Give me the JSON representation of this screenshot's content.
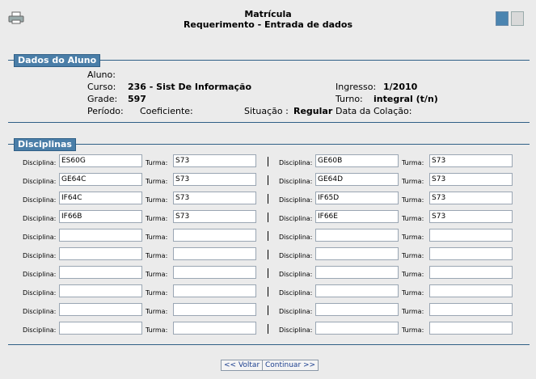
{
  "header": {
    "title": "Matrícula",
    "subtitle": "Requerimento - Entrada de dados"
  },
  "aluno": {
    "section_title": "Dados do Aluno",
    "aluno_label": "Aluno:",
    "curso_label": "Curso:",
    "curso_value": "236 - Sist De Informação",
    "grade_label": "Grade:",
    "grade_value": "597",
    "periodo_label": "Período:",
    "coeficiente_label": "Coeficiente:",
    "situacao_label": "Situação :",
    "situacao_value": "Regular",
    "ingresso_label": "Ingresso:",
    "ingresso_value": "1/2010",
    "turno_label": "Turno:",
    "turno_value": "integral (t/n)",
    "colacao_label": "Data da Colação:"
  },
  "disciplinas": {
    "section_title": "Disciplinas",
    "disciplina_label": "Disciplina:",
    "turma_label": "Turma:",
    "rows": [
      {
        "d1": "ES60G",
        "t1": "S73",
        "d2": "GE60B",
        "t2": "S73"
      },
      {
        "d1": "GE64C",
        "t1": "S73",
        "d2": "GE64D",
        "t2": "S73"
      },
      {
        "d1": "IF64C",
        "t1": "S73",
        "d2": "IF65D",
        "t2": "S73"
      },
      {
        "d1": "IF66B",
        "t1": "S73",
        "d2": "IF66E",
        "t2": "S73"
      },
      {
        "d1": "",
        "t1": "",
        "d2": "",
        "t2": ""
      },
      {
        "d1": "",
        "t1": "",
        "d2": "",
        "t2": ""
      },
      {
        "d1": "",
        "t1": "",
        "d2": "",
        "t2": ""
      },
      {
        "d1": "",
        "t1": "",
        "d2": "",
        "t2": ""
      },
      {
        "d1": "",
        "t1": "",
        "d2": "",
        "t2": ""
      },
      {
        "d1": "",
        "t1": "",
        "d2": "",
        "t2": ""
      }
    ]
  },
  "buttons": {
    "voltar": "<< Voltar",
    "continuar": "Continuar >>"
  }
}
